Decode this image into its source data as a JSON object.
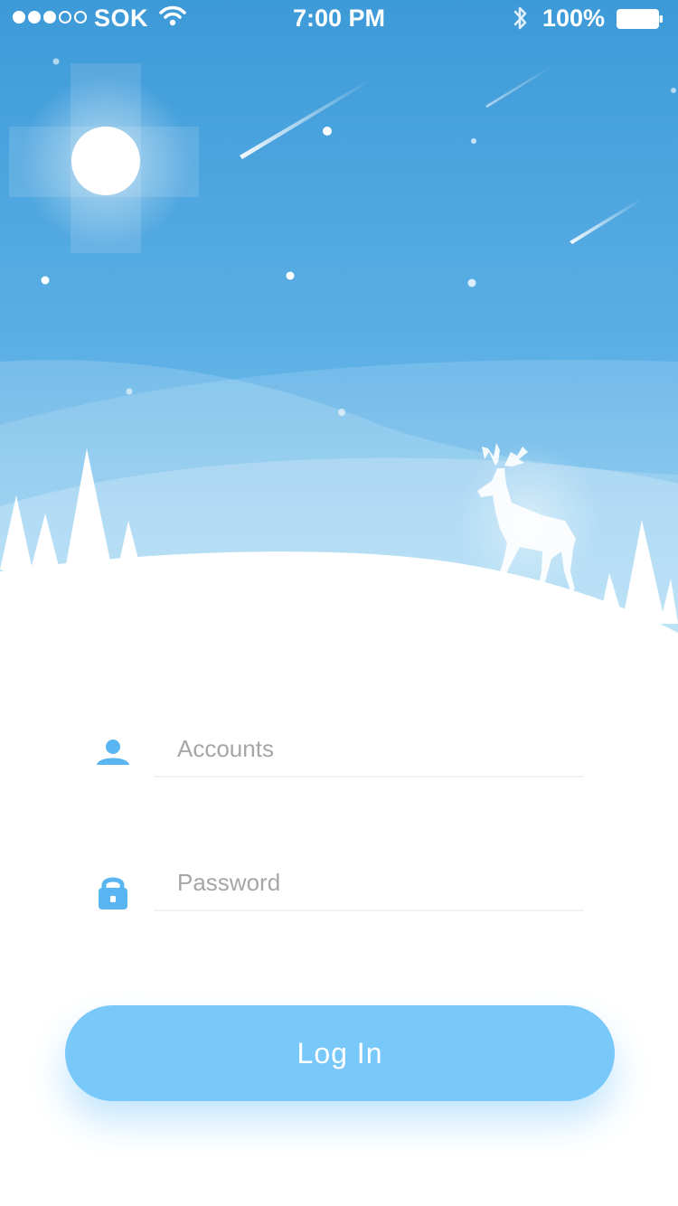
{
  "status_bar": {
    "carrier": "SOK",
    "time": "7:00 PM",
    "battery": "100%",
    "signal_bars_filled": 3,
    "signal_bars_total": 5
  },
  "scene": {
    "sky_top_color": "#3d9ad8",
    "sky_bottom_color": "#7cc4ee",
    "icons": [
      "moon-icon",
      "deer-icon",
      "meteor-icon",
      "pine-tree-icon"
    ]
  },
  "form": {
    "accounts": {
      "placeholder": "Accounts",
      "value": "",
      "icon": "user-icon"
    },
    "password": {
      "placeholder": "Password",
      "value": "",
      "icon": "lock-icon"
    }
  },
  "login_button": {
    "label": "Log In"
  },
  "colors": {
    "accent": "#79c8fa",
    "icon": "#5ab6f2",
    "placeholder": "#a6a6a6"
  }
}
